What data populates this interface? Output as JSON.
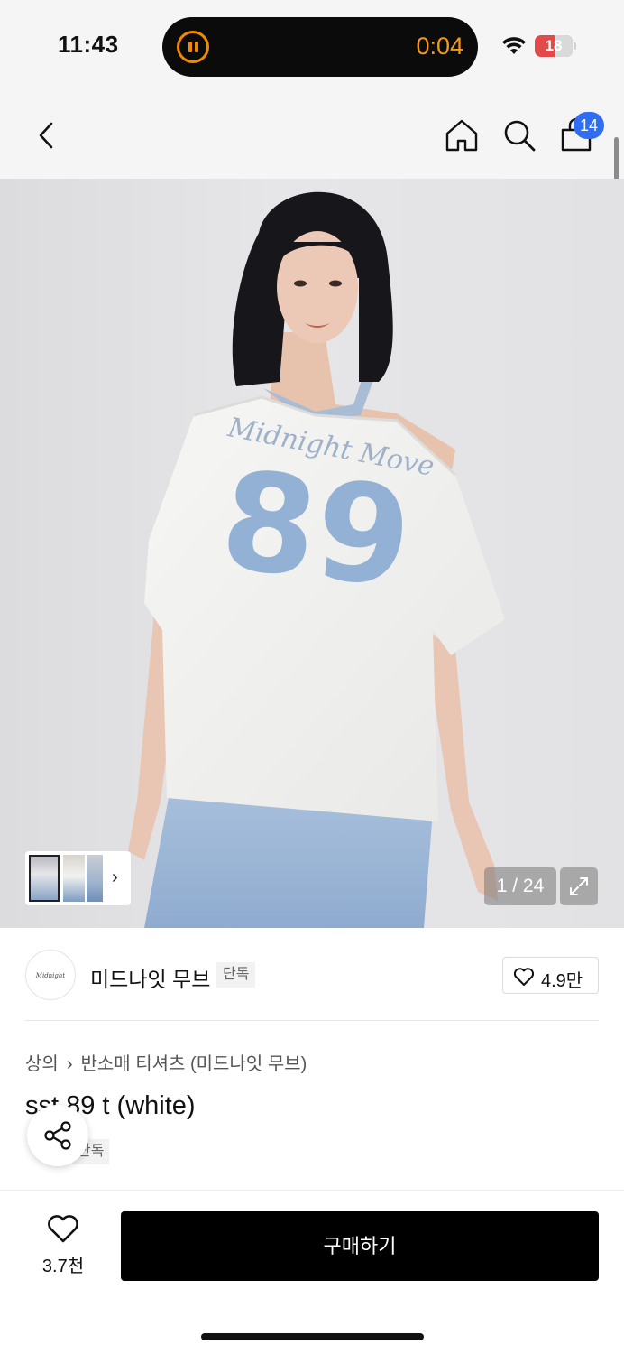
{
  "status_bar": {
    "time": "11:43",
    "activity_timer": "0:04",
    "battery_level": "18"
  },
  "nav": {
    "cart_count": "14",
    "icons": [
      "back-icon",
      "home-icon",
      "search-icon",
      "shopping-bag-icon"
    ]
  },
  "gallery": {
    "counter": "1 / 24",
    "current_index": 1,
    "total": 24,
    "thumbnail_chevron": "›"
  },
  "brand": {
    "logo_text": "Midnight Move",
    "name": "미드나잇 무브",
    "badge": "단독",
    "likes": "4.9만"
  },
  "product": {
    "breadcrumb": [
      "상의",
      "반소매 티셔츠 (미드나잇 무브)"
    ],
    "title": "sst 89 t (white)",
    "tag": "단독",
    "print_script": "Midnight Move",
    "print_number": "89"
  },
  "bottom_bar": {
    "wish_count": "3.7천",
    "buy_label": "구매하기"
  },
  "colors": {
    "cart_badge": "#2f6ef2",
    "activity_orange": "#f08a00",
    "buy_button": "#000000"
  }
}
